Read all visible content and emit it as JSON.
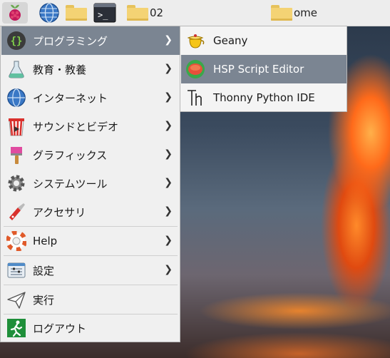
{
  "panel": {
    "launchers": [
      {
        "icon": "raspberry-pi-icon"
      },
      {
        "icon": "web-browser-icon"
      },
      {
        "icon": "file-manager-icon"
      },
      {
        "icon": "terminal-icon"
      }
    ],
    "tasks": [
      {
        "icon": "folder-icon",
        "label": "02"
      },
      {
        "icon": "folder-icon",
        "label": "ome"
      }
    ]
  },
  "menu": {
    "items": [
      {
        "label": "プログラミング",
        "icon": "programming-icon",
        "submenu": true
      },
      {
        "label": "教育・教養",
        "icon": "education-icon",
        "submenu": true
      },
      {
        "label": "インターネット",
        "icon": "internet-icon",
        "submenu": true
      },
      {
        "label": "サウンドとビデオ",
        "icon": "sound-video-icon",
        "submenu": true
      },
      {
        "label": "グラフィックス",
        "icon": "graphics-icon",
        "submenu": true
      },
      {
        "label": "システムツール",
        "icon": "system-tools-icon",
        "submenu": true
      },
      {
        "label": "アクセサリ",
        "icon": "accessories-icon",
        "submenu": true
      },
      {
        "label": "Help",
        "icon": "help-icon",
        "submenu": true
      },
      {
        "label": "設定",
        "icon": "settings-icon",
        "submenu": true
      },
      {
        "label": "実行",
        "icon": "run-icon",
        "submenu": false
      },
      {
        "label": "ログアウト",
        "icon": "logout-icon",
        "submenu": false
      }
    ]
  },
  "submenu": {
    "items": [
      {
        "label": "Geany",
        "icon": "geany-icon"
      },
      {
        "label": "HSP Script Editor",
        "icon": "hsp-script-editor-icon"
      },
      {
        "label": "Thonny Python IDE",
        "icon": "thonny-icon"
      }
    ]
  },
  "colors": {
    "highlight": "#7b8592",
    "menu_bg": "#f0f0f0",
    "panel_bg": "#ededed"
  }
}
